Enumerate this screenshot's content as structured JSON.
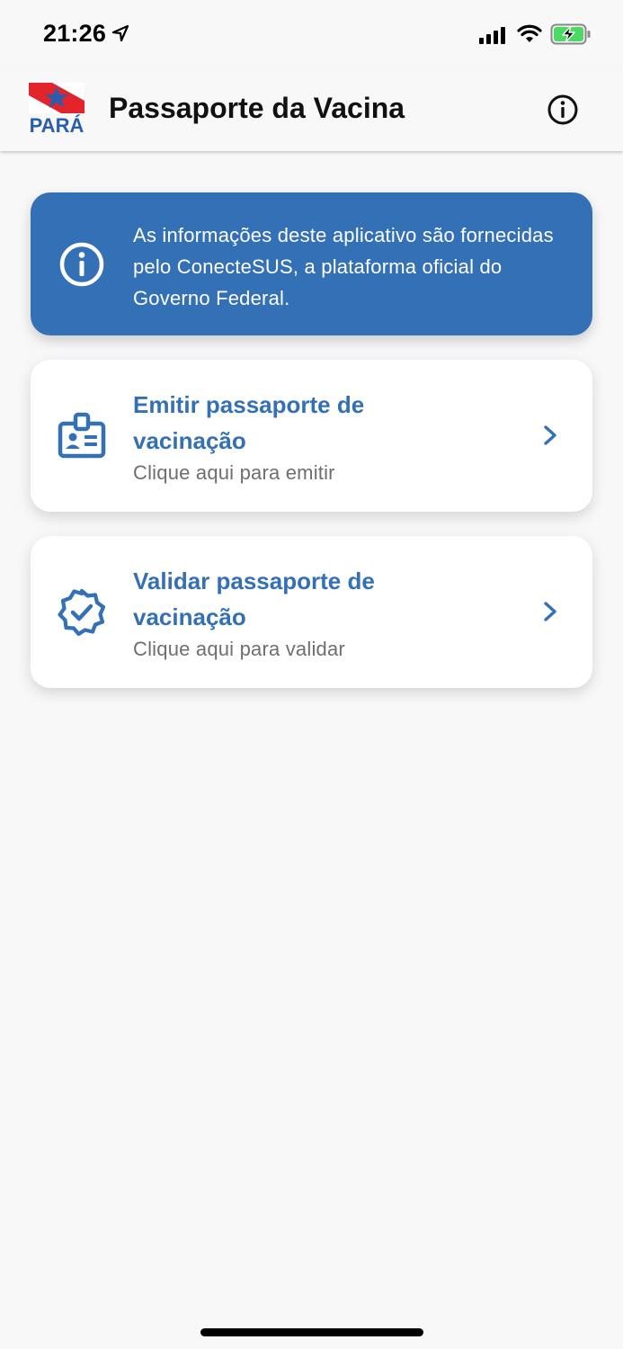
{
  "status_bar": {
    "time": "21:26",
    "icons": [
      "location-arrow-icon",
      "cellular-signal-icon",
      "wifi-icon",
      "battery-charging-icon"
    ]
  },
  "header": {
    "logo_text": "PARÁ",
    "title": "Passaporte da Vacina",
    "info_icon": "info-circle-icon"
  },
  "notice": {
    "icon": "info-circle-icon",
    "text": "As informações deste aplicativo são fornecidas pelo ConecteSUS, a plataforma oficial do Governo Federal."
  },
  "cards": [
    {
      "icon": "id-badge-icon",
      "title": "Emitir passaporte de vacinação",
      "subtitle": "Clique aqui para emitir"
    },
    {
      "icon": "verified-badge-icon",
      "title": "Validar passaporte de vacinação",
      "subtitle": "Clique aqui para validar"
    }
  ],
  "colors": {
    "accent": "#3470b6",
    "background": "#f8f8f9",
    "card": "#ffffff",
    "subtitle": "#6e6e73",
    "flag_red": "#e2242b"
  }
}
